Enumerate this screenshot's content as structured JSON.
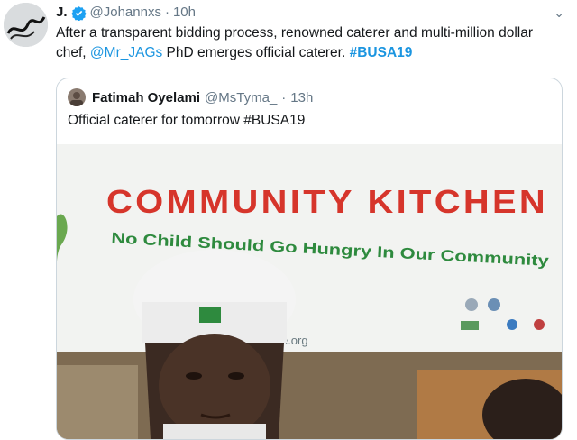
{
  "tweet": {
    "author_name": "J.",
    "author_handle": "@Johannxs",
    "separator": "·",
    "time": "10h",
    "text_before": "After a transparent bidding process, renowned caterer and multi-million dollar chef, ",
    "mention": "@Mr_JAGs",
    "text_middle": " PhD emerges official caterer. ",
    "hashtag": "#BUSA19"
  },
  "quoted": {
    "author_name": "Fatimah Oyelami",
    "author_handle": "@MsTyma_",
    "separator": "·",
    "time": "13h",
    "text": "Official caterer for tomorrow #BUSA19"
  },
  "banner": {
    "title": "COMMUNITY KITCHEN",
    "slogan": "No Child Should Go Hungry In Our Community",
    "url_fragment": ".ique.org"
  },
  "colors": {
    "link": "#1b95e0",
    "verified": "#1da1f2",
    "banner_red": "#d6352b",
    "banner_green": "#2e8a3e"
  },
  "icons": [
    "verified-badge-icon",
    "chevron-down-icon"
  ]
}
